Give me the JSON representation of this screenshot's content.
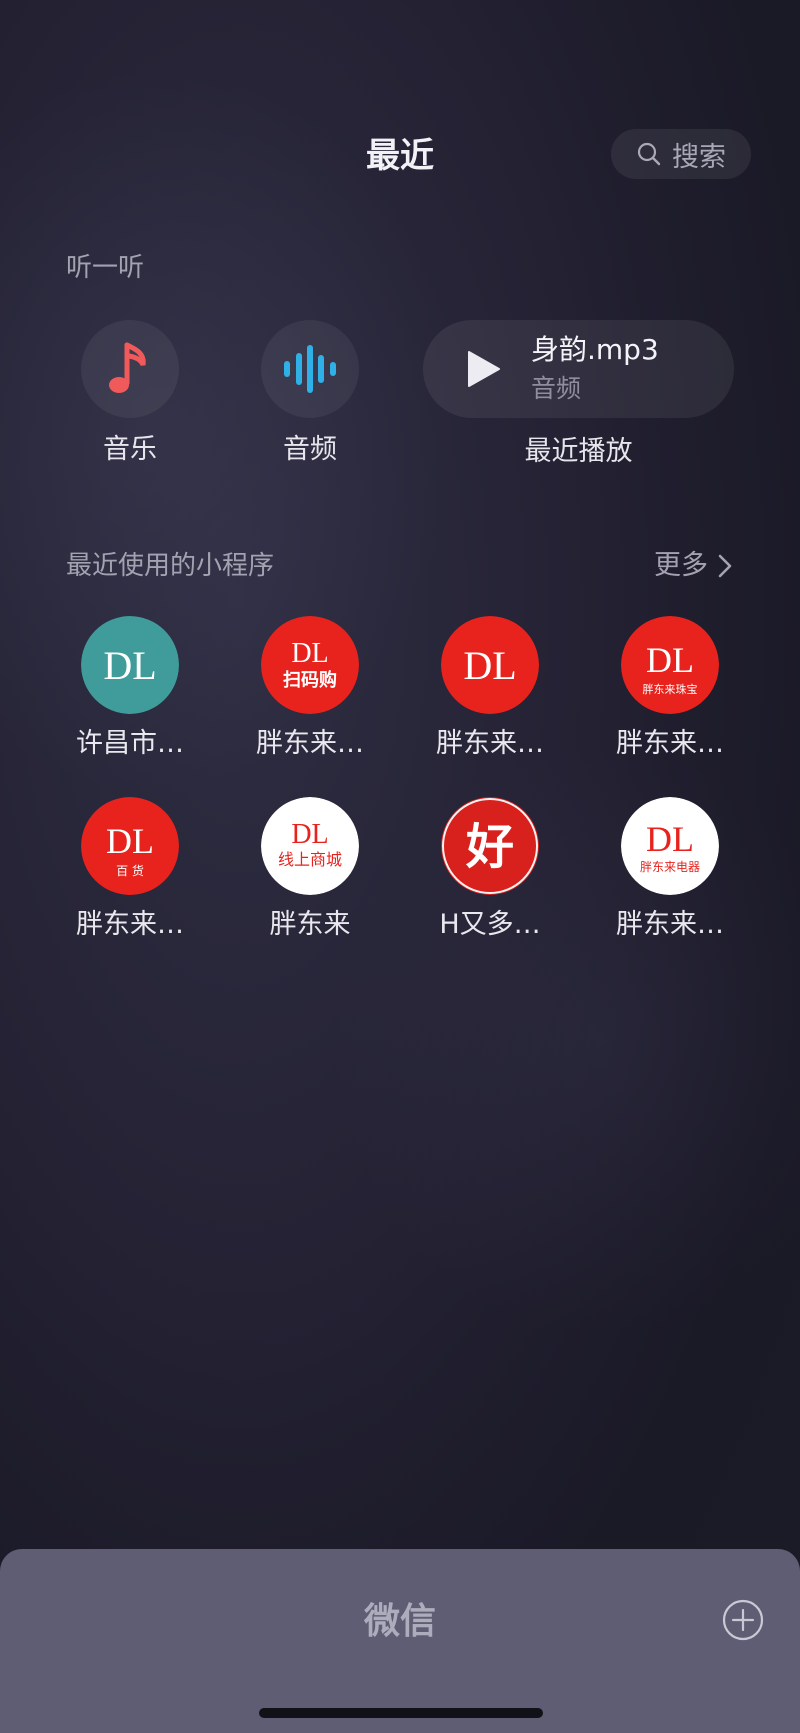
{
  "header": {
    "title": "最近",
    "search_label": "搜索"
  },
  "listen": {
    "section_label": "听一听",
    "music_label": "音乐",
    "audio_label": "音频",
    "recent": {
      "track": "身韵.mp3",
      "type": "音频",
      "label": "最近播放"
    }
  },
  "mini_programs": {
    "section_label": "最近使用的小程序",
    "more_label": "更多",
    "items": [
      {
        "label": "许昌市…",
        "icon_text": "DL",
        "icon_bg": "#3f9c9a"
      },
      {
        "label": "胖东来…",
        "icon_text": "DL",
        "icon_sub": "扫码购",
        "icon_bg": "#e8231e"
      },
      {
        "label": "胖东来…",
        "icon_text": "DL",
        "icon_bg": "#e8231e"
      },
      {
        "label": "胖东来…",
        "icon_text": "DL",
        "icon_sub": "胖东来珠宝",
        "icon_bg": "#e8231e"
      },
      {
        "label": "胖东来…",
        "icon_text": "DL",
        "icon_sub": "百 货",
        "icon_bg": "#e8231e"
      },
      {
        "label": "胖东来",
        "icon_text": "DL",
        "icon_sub": "线上商城",
        "icon_bg": "#ffffff"
      },
      {
        "label": "H又多…",
        "icon_text": "好",
        "icon_bg": "#d8201c"
      },
      {
        "label": "胖东来…",
        "icon_text": "DL",
        "icon_sub": "胖东来电器",
        "icon_bg": "#ffffff"
      }
    ]
  },
  "bottom_sheet": {
    "title": "微信"
  },
  "colors": {
    "music_accent": "#f05a5a",
    "audio_accent": "#2fb1e8",
    "brand_red": "#e8231e",
    "brand_teal": "#3f9c9a"
  }
}
